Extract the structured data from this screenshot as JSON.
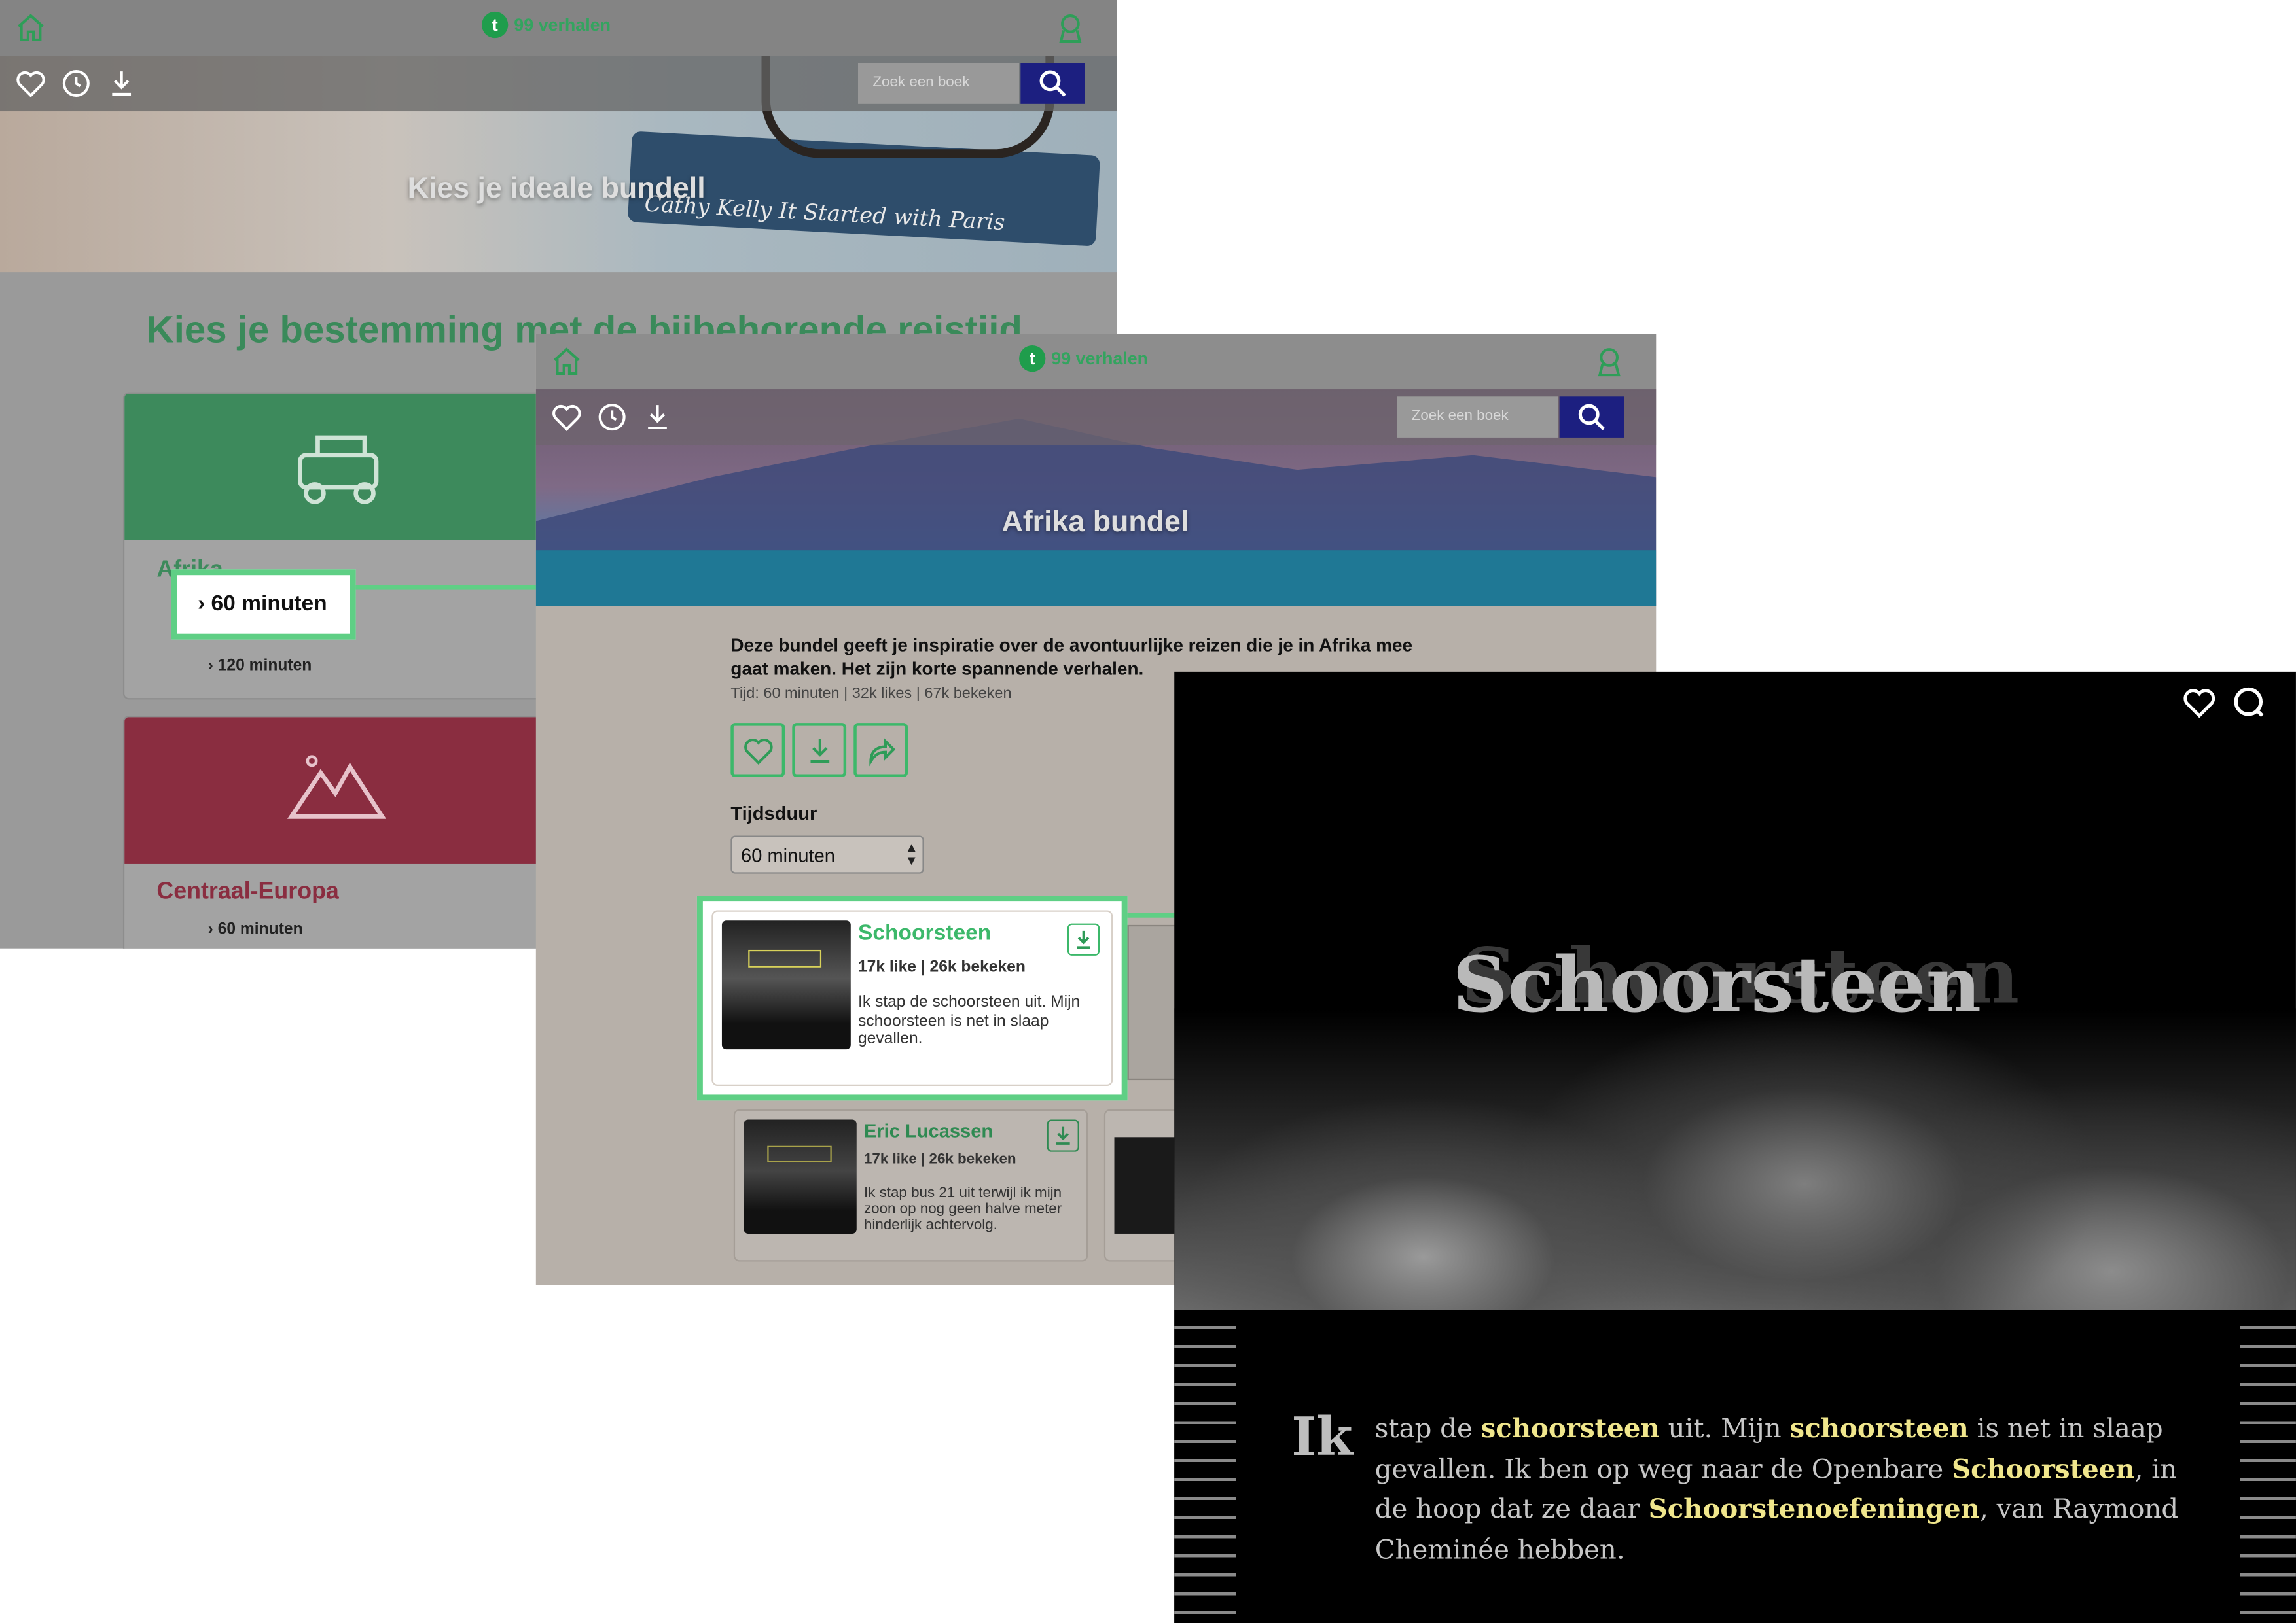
{
  "colors": {
    "green": "#3cb86a",
    "brand_green": "#1f9d4c",
    "red": "#c4354f",
    "navy": "#1c1f80",
    "highlight": "#f0e68c"
  },
  "screen1": {
    "brand": "99 verhalen",
    "search_placeholder": "Zoek een boek",
    "hero_title": "Kies je ideale bundell",
    "hero_book_text": "Cathy Kelly  It Started with Paris",
    "heading": "Kies je bestemming met de bijbehorende reistijd",
    "cards": [
      {
        "label": "Afrika",
        "icon": "jeep-icon",
        "options": [
          "› 60 minuten",
          "› 120 minuten"
        ]
      },
      {
        "label": "Centraal-Europa",
        "icon": "mountains-icon",
        "options": [
          "› 60 minuten"
        ]
      }
    ],
    "callout": "› 60 minuten"
  },
  "screen2": {
    "brand": "99 verhalen",
    "search_placeholder": "Zoek een boek",
    "hero_title": "Afrika bundel",
    "description": "Deze bundel geeft je inspiratie over de avontuurlijke reizen die je in Afrika mee gaat maken. Het zijn korte spannende verhalen.",
    "meta": "Tijd: 60 minuten | 32k likes | 67k bekeken",
    "duration_label": "Tijdsduur",
    "duration_value": "60 minuten",
    "stories": [
      {
        "title": "Schoorsteen",
        "stats": "17k like | 26k bekeken",
        "excerpt": "Ik stap de schoorsteen uit. Mijn schoorsteen is net in slaap gevallen."
      },
      {
        "title": "Eric Lucassen",
        "stats": "17k like | 26k bekeken",
        "excerpt": "Ik stap bus 21 uit terwijl ik mijn zoon op nog geen halve meter hinderlijk achtervolg."
      }
    ]
  },
  "screen3": {
    "title": "Schoorsteen",
    "drop_cap": "Ik",
    "body": [
      {
        "t": "stap de ",
        "h": false
      },
      {
        "t": "schoorsteen",
        "h": true
      },
      {
        "t": " uit. Mijn ",
        "h": false
      },
      {
        "t": "schoorsteen",
        "h": true
      },
      {
        "t": " is net in slaap gevallen. Ik ben op weg naar de Openbare ",
        "h": false
      },
      {
        "t": "Schoorsteen",
        "h": true
      },
      {
        "t": ", in de hoop dat ze daar ",
        "h": false
      },
      {
        "t": "Schoorstenoefeningen",
        "h": true
      },
      {
        "t": ", van Raymond Cheminée hebben.",
        "h": false
      }
    ]
  }
}
